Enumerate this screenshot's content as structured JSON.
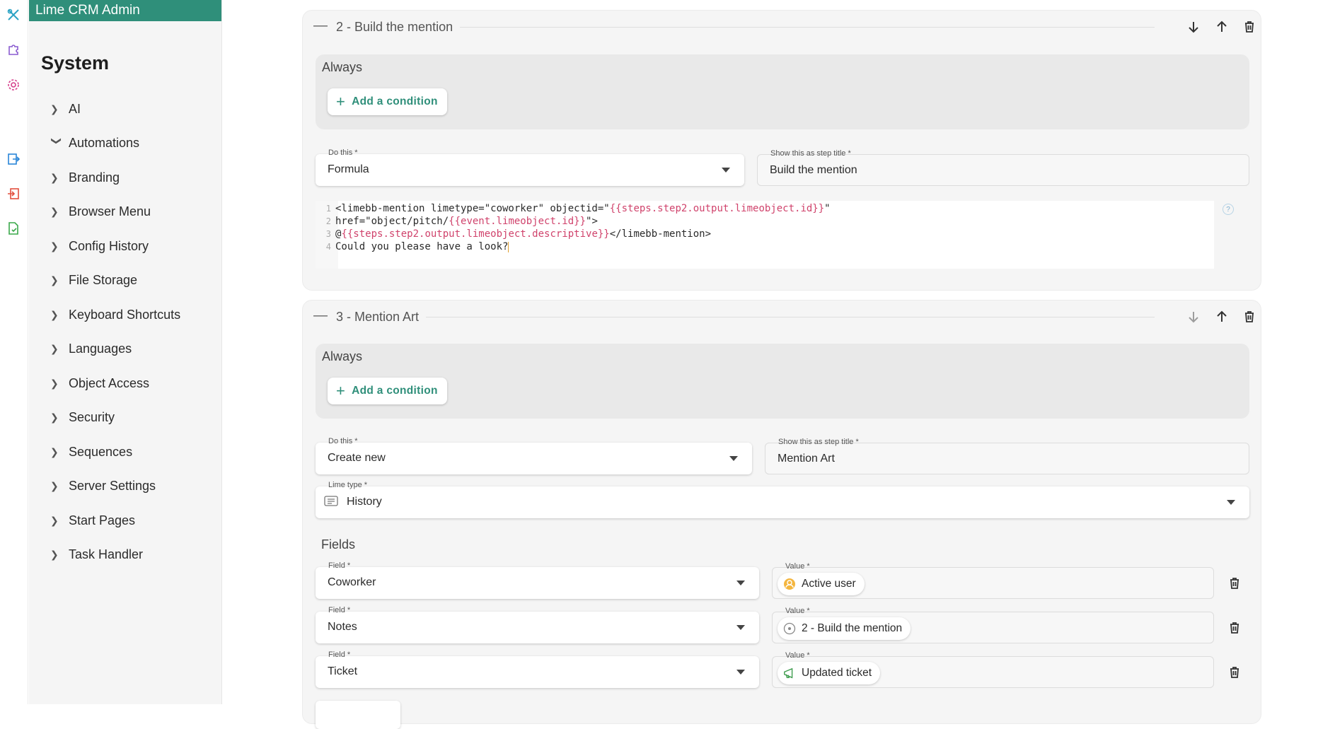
{
  "app": {
    "title": "Lime CRM Admin"
  },
  "rail": {
    "icons": [
      "tools-icon",
      "puzzle-icon",
      "gear-icon",
      "export-icon",
      "import-icon",
      "file-check-icon"
    ]
  },
  "sidebar": {
    "section_title": "System",
    "items": [
      {
        "label": "AI",
        "expanded": false
      },
      {
        "label": "Automations",
        "expanded": true
      },
      {
        "label": "Branding",
        "expanded": false
      },
      {
        "label": "Browser Menu",
        "expanded": false
      },
      {
        "label": "Config History",
        "expanded": false
      },
      {
        "label": "File Storage",
        "expanded": false
      },
      {
        "label": "Keyboard Shortcuts",
        "expanded": false
      },
      {
        "label": "Languages",
        "expanded": false
      },
      {
        "label": "Object Access",
        "expanded": false
      },
      {
        "label": "Security",
        "expanded": false
      },
      {
        "label": "Sequences",
        "expanded": false
      },
      {
        "label": "Server Settings",
        "expanded": false
      },
      {
        "label": "Start Pages",
        "expanded": false
      },
      {
        "label": "Task Handler",
        "expanded": false
      }
    ]
  },
  "step2": {
    "title": "2 - Build the mention",
    "condition_label": "Always",
    "add_condition": "Add a condition",
    "do_this_label": "Do this *",
    "do_this_value": "Formula",
    "step_title_label": "Show this as step title *",
    "step_title_value": "Build the mention",
    "help": "?",
    "code": {
      "line_numbers": [
        "1",
        "2",
        "3",
        "4"
      ],
      "l1a": "<limebb-mention limetype=\"coworker\" objectid=\"",
      "l1b": "{{steps.step2.output.limeobject.id}}",
      "l1c": "\"",
      "l2a": "href=\"object/pitch/",
      "l2b": "{{event.limeobject.id}}",
      "l2c": "\">",
      "l3a": "@",
      "l3b": "{{steps.step2.output.limeobject.descriptive}}",
      "l3c": "</limebb-mention>",
      "l4": "Could you please have a look?"
    }
  },
  "step3": {
    "title": "3 - Mention Art",
    "condition_label": "Always",
    "add_condition": "Add a condition",
    "do_this_label": "Do this *",
    "do_this_value": "Create new",
    "step_title_label": "Show this as step title *",
    "step_title_value": "Mention Art",
    "lime_type_label": "Lime type *",
    "lime_type_value": "History",
    "fields_title": "Fields",
    "field_label": "Field *",
    "value_label": "Value *",
    "rows": [
      {
        "field": "Coworker",
        "value": "Active user",
        "icon": "user-circle-icon"
      },
      {
        "field": "Notes",
        "value": "2 - Build the mention",
        "icon": "step-circle-icon"
      },
      {
        "field": "Ticket",
        "value": "Updated ticket",
        "icon": "megaphone-icon"
      }
    ]
  },
  "colors": {
    "accent": "#2f8f7a",
    "code_token": "#d0436c"
  }
}
